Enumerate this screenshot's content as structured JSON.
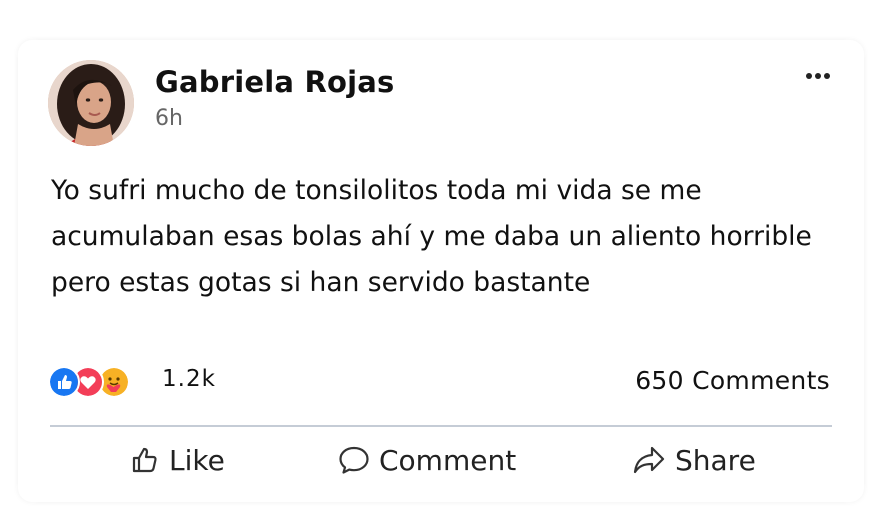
{
  "post": {
    "author": "Gabriela Rojas",
    "time": "6h",
    "text": "Yo sufri mucho de tonsilolitos toda mi vida se me acumulaban esas bolas ahí y me daba un aliento horrible pero estas gotas si han servido bastante"
  },
  "stats": {
    "reaction_count": "1.2k",
    "comments": "650 Comments",
    "reactions": [
      "like-icon",
      "love-icon",
      "care-icon"
    ]
  },
  "actions": {
    "like": "Like",
    "comment": "Comment",
    "share": "Share"
  },
  "colors": {
    "like_blue": "#1877f2",
    "love_red": "#f33e58",
    "care_yellow": "#f7b125",
    "divider": "#c5ccd6",
    "muted": "#666666"
  }
}
